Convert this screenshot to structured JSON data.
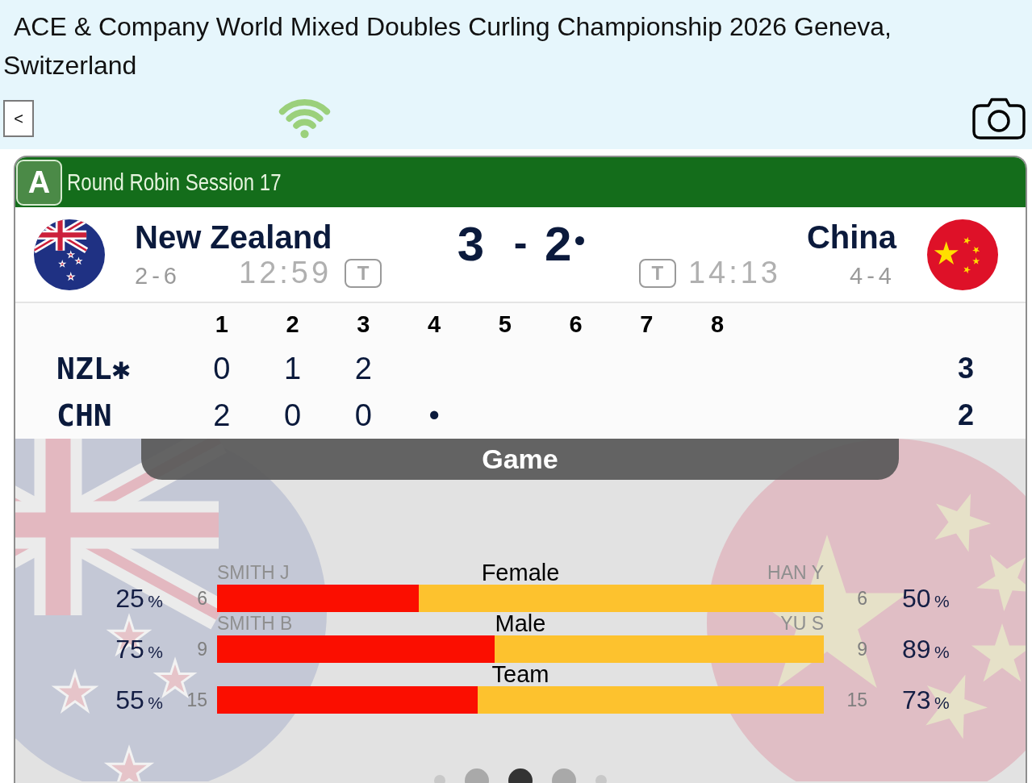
{
  "header": {
    "title": "ACE & Company World Mixed Doubles Curling Championship 2026 Geneva, Switzerland"
  },
  "toolbar": {
    "back": "<"
  },
  "game": {
    "sheet": "A",
    "session": "Round Robin Session 17",
    "score_separator": "-",
    "teams": [
      {
        "kind": "nz",
        "name": "New Zealand",
        "record": "2-6",
        "time": "12:59",
        "timeout": "T",
        "score": "3",
        "hammer": false
      },
      {
        "kind": "cn",
        "name": "China",
        "record": "4-4",
        "time": "14:13",
        "timeout": "T",
        "score": "2",
        "hammer": true
      }
    ]
  },
  "linescore": {
    "ends": [
      "1",
      "2",
      "3",
      "4",
      "5",
      "6",
      "7",
      "8"
    ],
    "rows": [
      {
        "team": "NZL✱",
        "scores": [
          "0",
          "1",
          "2"
        ],
        "total": "3"
      },
      {
        "team": "CHN",
        "scores": [
          "2",
          "0",
          "0",
          "•"
        ],
        "total": "2"
      }
    ]
  },
  "stats_title": "Game",
  "stats": [
    {
      "label": "Female",
      "left_name": "SMITH J",
      "right_name": "HAN Y",
      "left_count": "6",
      "right_count": "6",
      "left_percent": "25",
      "left_unit": "%",
      "right_percent": "50",
      "right_unit": "%",
      "level": 0.333
    },
    {
      "label": "Male",
      "left_name": "SMITH B",
      "right_name": "YU S",
      "left_count": "9",
      "right_count": "9",
      "left_percent": "75",
      "left_unit": "%",
      "right_percent": "89",
      "right_unit": "%",
      "level": 0.457
    },
    {
      "label": "Team",
      "left_count": "15",
      "right_count": "15",
      "left_percent": "55",
      "left_unit": "%",
      "right_percent": "73",
      "right_unit": "%",
      "level": 0.43
    }
  ],
  "pager": [
    {
      "selected": false
    },
    {
      "selected": false
    },
    {
      "selected": true
    },
    {
      "selected": false
    },
    {
      "selected": false
    }
  ]
}
